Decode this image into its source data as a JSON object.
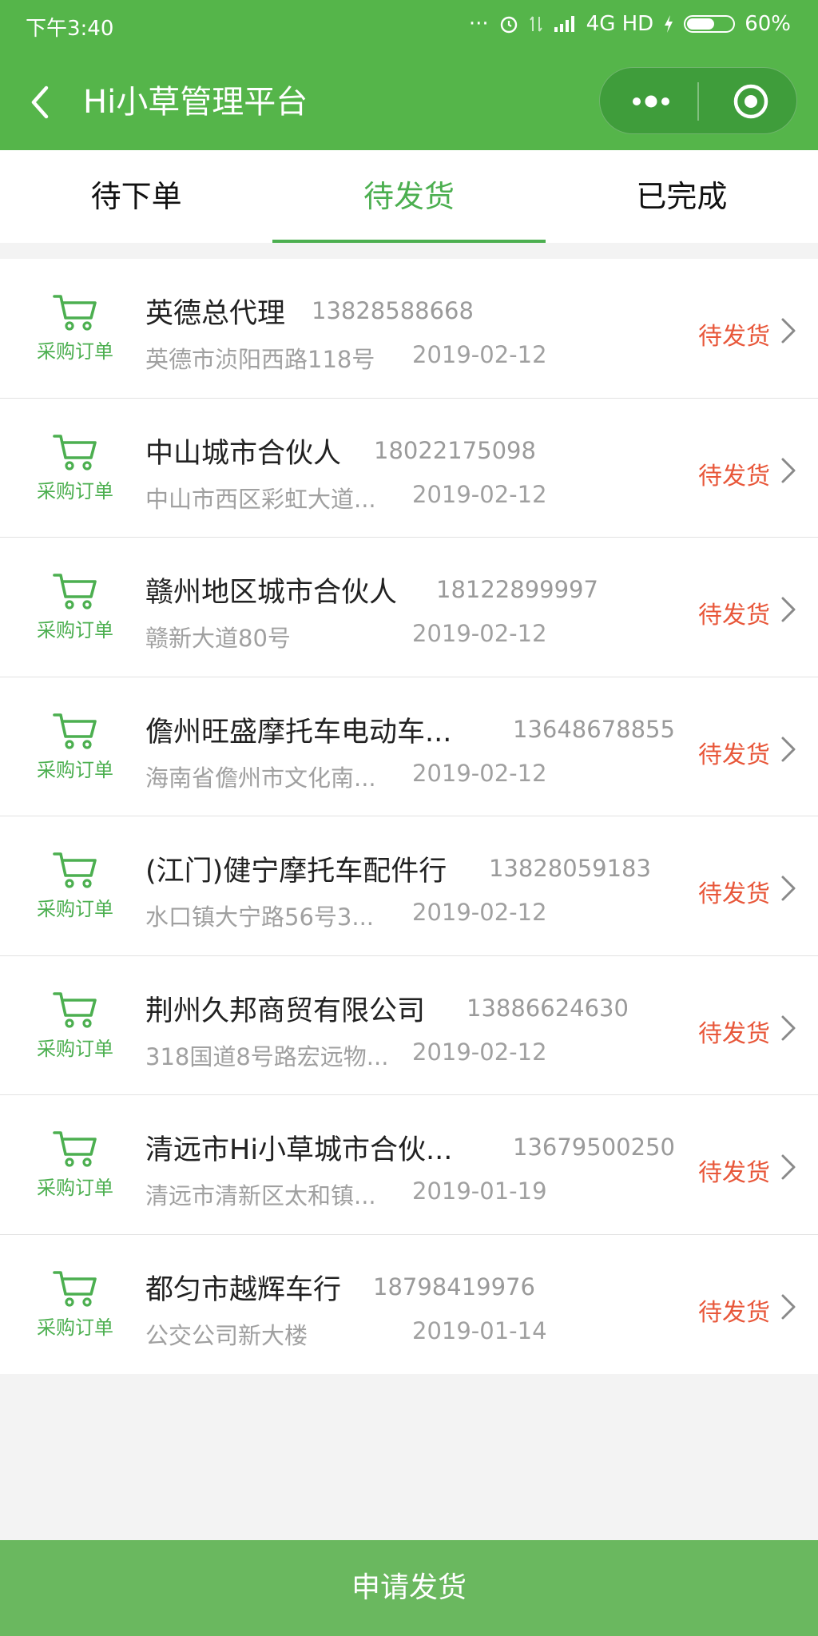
{
  "status_bar": {
    "time": "下午3:40",
    "network": "4G HD",
    "battery_text": "60%",
    "battery_level": 0.6
  },
  "nav": {
    "title": "Hi小草管理平台"
  },
  "tabs": [
    {
      "label": "待下单",
      "active": false
    },
    {
      "label": "待发货",
      "active": true
    },
    {
      "label": "已完成",
      "active": false
    }
  ],
  "orders": [
    {
      "type_label": "采购订单",
      "name": "英德总代理",
      "phone": "13828588668",
      "address": "英德市浈阳西路118号",
      "date": "2019-02-12",
      "status": "待发货"
    },
    {
      "type_label": "采购订单",
      "name": "中山城市合伙人",
      "phone": "18022175098",
      "address": "中山市西区彩虹大道...",
      "date": "2019-02-12",
      "status": "待发货"
    },
    {
      "type_label": "采购订单",
      "name": "赣州地区城市合伙人",
      "phone": "18122899997",
      "address": "赣新大道80号",
      "date": "2019-02-12",
      "status": "待发货"
    },
    {
      "type_label": "采购订单",
      "name": "儋州旺盛摩托车电动车...",
      "phone": "13648678855",
      "address": "海南省儋州市文化南...",
      "date": "2019-02-12",
      "status": "待发货"
    },
    {
      "type_label": "采购订单",
      "name": "(江门)健宁摩托车配件行",
      "phone": "13828059183",
      "address": "水口镇大宁路56号3...",
      "date": "2019-02-12",
      "status": "待发货"
    },
    {
      "type_label": "采购订单",
      "name": "荆州久邦商贸有限公司",
      "phone": "13886624630",
      "address": "318国道8号路宏远物...",
      "date": "2019-02-12",
      "status": "待发货"
    },
    {
      "type_label": "采购订单",
      "name": "清远市Hi小草城市合伙...",
      "phone": "13679500250",
      "address": "清远市清新区太和镇...",
      "date": "2019-01-19",
      "status": "待发货"
    },
    {
      "type_label": "采购订单",
      "name": "都匀市越辉车行",
      "phone": "18798419976",
      "address": "公交公司新大楼",
      "date": "2019-01-14",
      "status": "待发货"
    }
  ],
  "bottom": {
    "button_label": "申请发货"
  },
  "colors": {
    "brand_green": "#55b54a",
    "status_orange": "#e8573a",
    "button_green": "#6ab85f"
  }
}
